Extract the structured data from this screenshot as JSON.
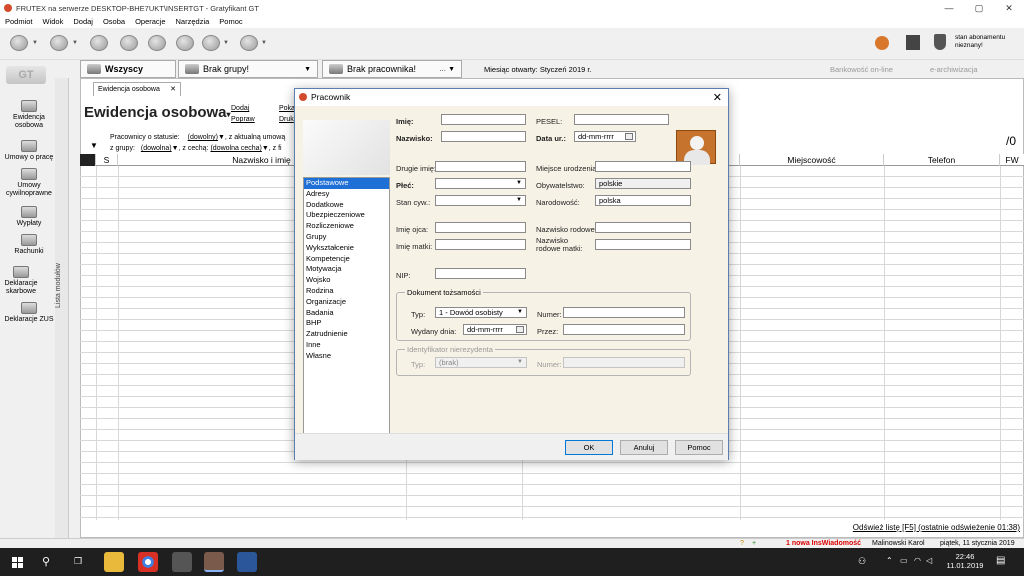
{
  "window": {
    "title": "FRUTEX na serwerze DESKTOP-BHE7UKT\\INSERTGT - Gratyfikant GT"
  },
  "menu": [
    "Podmiot",
    "Widok",
    "Dodaj",
    "Osoba",
    "Operacje",
    "Narzędzia",
    "Pomoc"
  ],
  "subscription": "stan abonamentu\nnieznany!",
  "left_panel": [
    "Ewidencja osobowa",
    "Umowy o pracę",
    "Umowy cywilnoprawne",
    "Wypłaty",
    "Rachunki",
    "Deklaracje skarbowe",
    "Deklaracje ZUS"
  ],
  "lista_modulow": "Lista modułów",
  "tabs": {
    "wszyscy": "Wszyscy",
    "brak_grupy": "Brak grupy!",
    "brak_pracownika": "Brak pracownika!",
    "miesiac": "Miesiąc otwarty: Styczeń 2019 r.",
    "bankowosc": "Bankowość on-line",
    "earch": "e-archiwizacja"
  },
  "subtab": "Ewidencja osobowa",
  "page": {
    "title": "Ewidencja osobowa",
    "dodaj": "Dodaj",
    "popraw": "Popraw",
    "poka": "Poka",
    "druk": "Druk",
    "filter1_label": "Pracownicy o statusie:",
    "filter1_value": "(dowolny)",
    "filter1_tail": ", z aktualną umową",
    "filter2_label": "z grupy:",
    "filter2_value": "(dowolna)",
    "filter2_mid": ", z cechą:",
    "filter2_value2": "(dowolna cecha)",
    "filter2_tail": ", z fi",
    "count": "/0"
  },
  "grid": {
    "headers": [
      "S",
      "Nazwisko i imię",
      "Miejscowość",
      "Telefon",
      "FW"
    ]
  },
  "refresh": "Odśwież listę [F5] (ostatnie odświeżenie 01:38)",
  "status": {
    "news": "1 nowa InsWiadomość",
    "user": "Malinowski Karol",
    "date": "piątek, 11 stycznia 2019"
  },
  "taskbar": {
    "time": "22:46",
    "date": "11.01.2019"
  },
  "dialog": {
    "title": "Pracownik",
    "nav": [
      "Podstawowe",
      "Adresy",
      "Dodatkowe",
      "Ubezpieczeniowe",
      "Rozliczeniowe",
      "Grupy",
      "Wykształcenie",
      "Kompetencje",
      "Motywacja",
      "Wojsko",
      "Rodzina",
      "Organizacje",
      "Badania",
      "BHP",
      "Zatrudnienie",
      "Inne",
      "Własne"
    ],
    "labels": {
      "imie": "Imię:",
      "nazwisko": "Nazwisko:",
      "pesel": "PESEL:",
      "data_ur": "Data ur.:",
      "drugie_imie": "Drugie imię:",
      "plec": "Płeć:",
      "stan_cyw": "Stan cyw.:",
      "miejsce_ur": "Miejsce urodzenia:",
      "obywatelstwo": "Obywatelstwo:",
      "narodowosc": "Narodowość:",
      "imie_ojca": "Imię ojca:",
      "imie_matki": "Imię matki:",
      "nazwisko_rodowe": "Nazwisko rodowe:",
      "nazwisko_rodowe_matki": "Nazwisko\nrodowe matki:",
      "nip": "NIP:",
      "dok_title": "Dokument tożsamości",
      "typ": "Typ:",
      "numer": "Numer:",
      "wydany": "Wydany dnia:",
      "przez": "Przez:",
      "ident_title": "Identyfikator nierezydenta",
      "typ2": "Typ:",
      "numer2": "Numer:"
    },
    "values": {
      "data_ur": "dd-mm-rrrr",
      "obywatelstwo": "polskie",
      "narodowosc": "polska",
      "dok_typ": "1 - Dowód osobisty",
      "wydany": "dd-mm-rrrr",
      "ident_typ": "(brak)"
    },
    "buttons": {
      "ok": "OK",
      "anuluj": "Anuluj",
      "pomoc": "Pomoc"
    }
  }
}
